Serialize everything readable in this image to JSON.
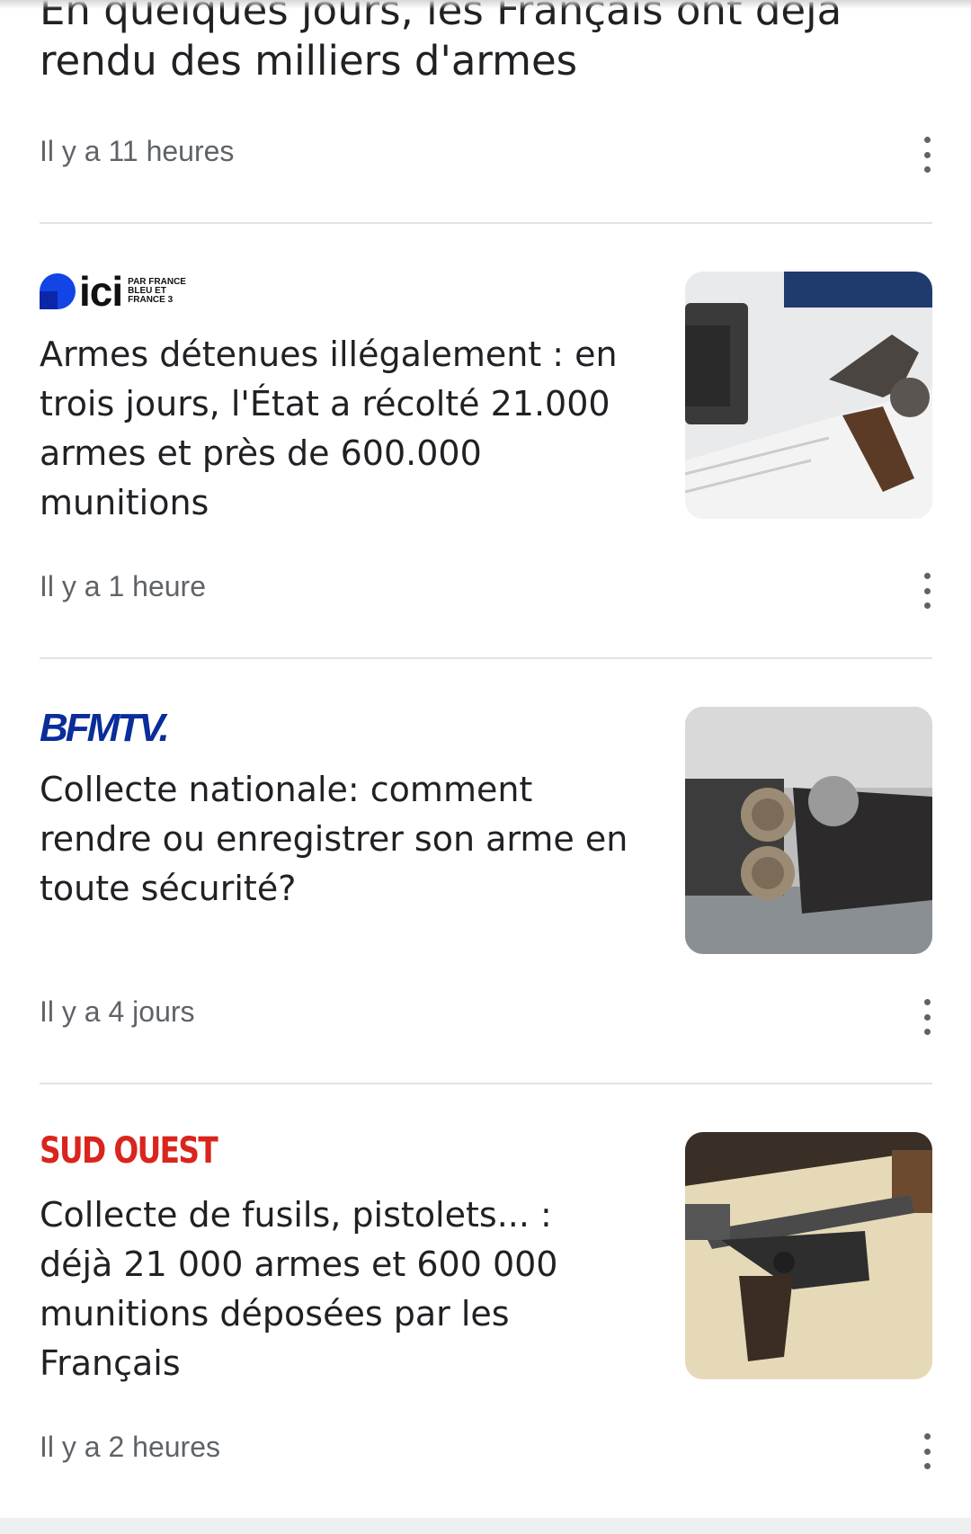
{
  "articles": [
    {
      "source": "",
      "title": "En quelques jours, les Français ont déjà rendu des milliers d'armes",
      "time": "Il y a 11 heures"
    },
    {
      "source": "ici",
      "source_sub": "PAR FRANCE BLEU ET FRANCE 3",
      "title": "Armes détenues illégalement : en trois jours, l'État a récolté 21.000 armes et près de 600.000 munitions",
      "time": "Il y a 1 heure",
      "thumbnail": "revolver-and-pistol-on-paper"
    },
    {
      "source": "BFMTV.",
      "title": "Collecte nationale: comment rendre ou enregistrer son arme en toute sécurité?",
      "time": "Il y a 4 jours",
      "thumbnail": "shotgun-cartridges-closeup"
    },
    {
      "source": "SUD OUEST",
      "title": "Collecte de fusils, pistolets... : déjà 21 000 armes et 600 000 munitions déposées par les Français",
      "time": "Il y a 2 heures",
      "thumbnail": "pistol-on-table"
    }
  ],
  "icons": {
    "more": "more-vert-icon"
  },
  "colors": {
    "ici": "#1344e5",
    "bfmtv": "#0a2d9a",
    "sudouest": "#d9251d",
    "meta": "#5f6368"
  }
}
